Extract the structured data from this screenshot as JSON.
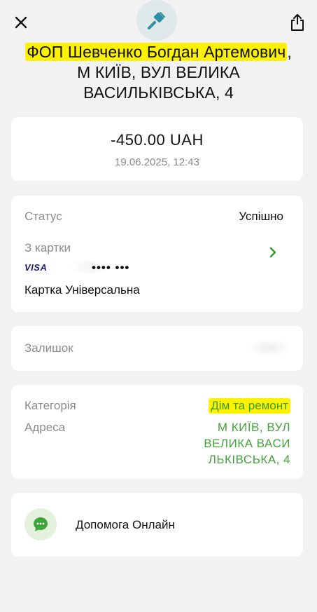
{
  "header": {
    "close_icon": "close-icon",
    "merchant_icon": "paint-brush-icon",
    "share_icon": "share-icon",
    "merchant_name": "ФОП Шевченко Богдан Артемович",
    "merchant_address_line1": "М КИЇВ, ВУЛ ВЕЛИКА",
    "merchant_address_line2": "ВАСИЛЬКІВСЬКА, 4"
  },
  "transaction": {
    "amount": "-450.00 UAH",
    "datetime": "19.06.2025, 12:43"
  },
  "status_section": {
    "status_label": "Статус",
    "status_value": "Успішно",
    "from_card_label": "З картки",
    "card_brand": "VISA",
    "card_masked": "•••• •••",
    "card_name": "Картка Універсальна"
  },
  "balance_section": {
    "label": "Залишок"
  },
  "details_section": {
    "category_label": "Категорія",
    "category_value": "Дім та ремонт",
    "address_label": "Адреса",
    "address_line1": "М КИЇВ,  ВУЛ",
    "address_line2": "ВЕЛИКА ВАСИ",
    "address_line3": "ЛЬКІВСЬКА,  4"
  },
  "help": {
    "label": "Допомога Онлайн",
    "icon": "chat-bubble-icon"
  },
  "colors": {
    "background": "#f2f2f2",
    "card": "#ffffff",
    "accent_green": "#44a23c",
    "highlight": "#fff200",
    "muted_text": "#8c8c8c"
  }
}
